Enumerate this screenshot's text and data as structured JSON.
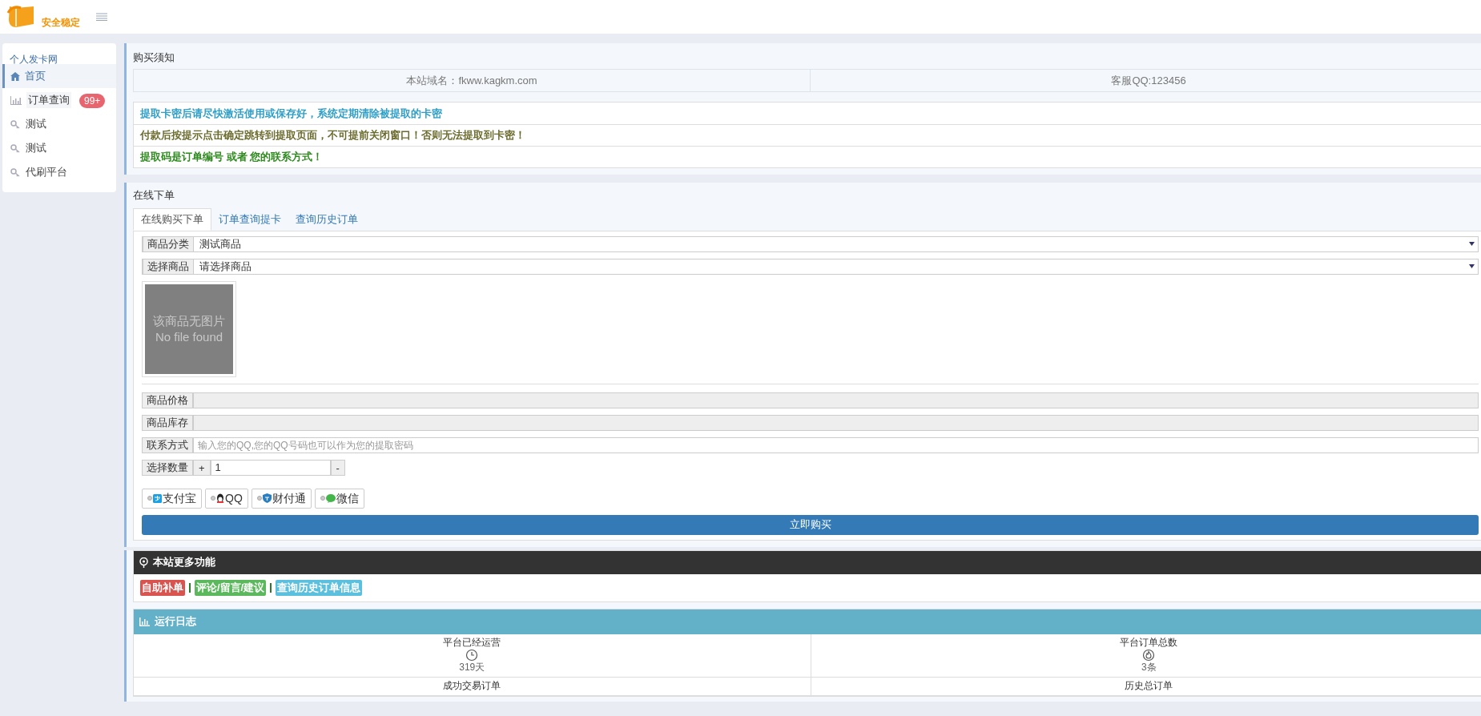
{
  "header": {
    "logo_text": "安全稳定"
  },
  "sidebar": {
    "title": "个人发卡网",
    "items": [
      {
        "label": "首页",
        "kind": "home",
        "selected": true
      },
      {
        "label": "订单查询",
        "kind": "chart",
        "badge": "99+",
        "selected": false
      },
      {
        "label": "测试",
        "kind": "key",
        "selected": false
      },
      {
        "label": "测试",
        "kind": "key",
        "selected": false
      },
      {
        "label": "代刷平台",
        "kind": "key",
        "selected": false
      }
    ]
  },
  "notice": {
    "title": "购买须知",
    "info": [
      "本站域名：fkww.kagkm.com",
      "客服QQ:123456"
    ],
    "messages": [
      {
        "text": "提取卡密后请尽快激活使用或保存好，系统定期清除被提取的卡密",
        "color": "#2f9fc8"
      },
      {
        "text": "付款后按提示点击确定跳转到提取页面，不可提前关闭窗口！否则无法提取到卡密！",
        "color": "#6b6b2e"
      },
      {
        "text": "提取码是订单编号 或者 您的联系方式！",
        "color": "#2e8b1e"
      }
    ]
  },
  "order": {
    "title": "在线下单",
    "tabs": [
      {
        "label": "在线购买下单",
        "selected": true
      },
      {
        "label": "订单查询提卡",
        "selected": false
      },
      {
        "label": "查询历史订单",
        "selected": false
      }
    ],
    "category": {
      "label": "商品分类",
      "value": "测试商品"
    },
    "product": {
      "label": "选择商品",
      "value": "请选择商品"
    },
    "image": {
      "lines": [
        "该商品无图片",
        "No file found"
      ]
    },
    "price": {
      "label": "商品价格"
    },
    "stock": {
      "label": "商品库存"
    },
    "contact": {
      "label": "联系方式",
      "placeholder": "输入您的QQ,您的QQ号码也可以作为您的提取密码"
    },
    "quantity": {
      "label": "选择数量",
      "plus": "+",
      "value": "1",
      "minus": "-"
    },
    "payments": [
      {
        "label": "支付宝",
        "kind": "alipay",
        "selected": false
      },
      {
        "label": "QQ",
        "kind": "qq",
        "selected": false
      },
      {
        "label": "财付通",
        "kind": "tenpay",
        "selected": false
      },
      {
        "label": "微信",
        "kind": "wechat",
        "selected": false
      }
    ],
    "buy_button": "立即购买"
  },
  "more": {
    "title": "本站更多功能",
    "links": [
      {
        "label": "自助补单",
        "color": "#d9534f"
      },
      {
        "label": "评论/留言/建议",
        "color": "#5cb85c"
      },
      {
        "label": "查询历史订单信息",
        "color": "#5bc0de"
      }
    ]
  },
  "log": {
    "title": "运行日志",
    "stats": [
      {
        "label": "平台已经运营",
        "kind": "clock",
        "value": "319天"
      },
      {
        "label": "平台订单总数",
        "kind": "fire",
        "value": "3条"
      },
      {
        "label": "成功交易订单"
      },
      {
        "label": "历史总订单"
      }
    ]
  }
}
